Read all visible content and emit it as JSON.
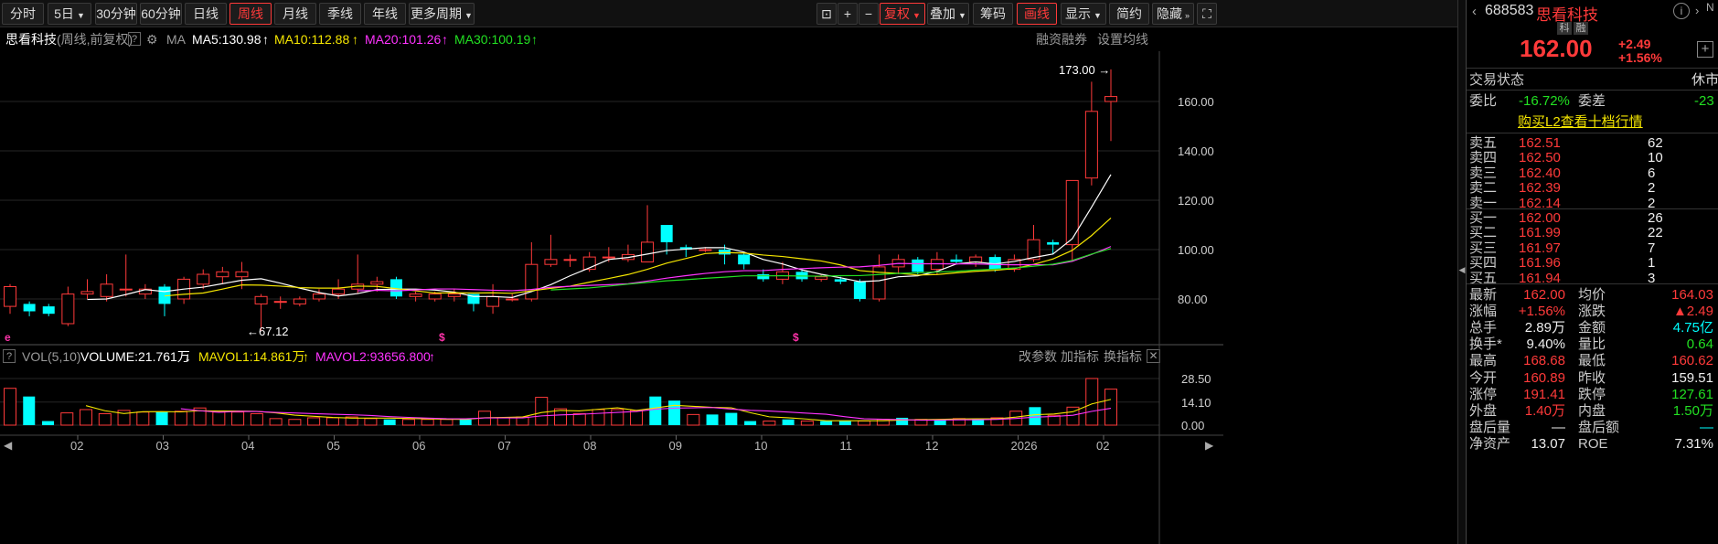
{
  "toolbar": {
    "periods": [
      "分时",
      "5日",
      "30分钟",
      "60分钟",
      "日线",
      "周线",
      "月线",
      "季线",
      "年线",
      "更多周期"
    ],
    "active_period": "周线",
    "tools": [
      "复权",
      "叠加",
      "筹码",
      "画线",
      "显示",
      "简约",
      "隐藏"
    ],
    "active_tools": [
      "复权",
      "画线"
    ]
  },
  "header": {
    "stock_name": "思看科技",
    "mode": "(周线,前复权)",
    "help": "?",
    "ma_label": "MA",
    "ma5": "MA5:130.98",
    "ma10": "MA10:112.88",
    "ma20": "MA20:101.26",
    "ma30": "MA30:100.19",
    "margin_trading": "融资融券",
    "ma_settings": "设置均线"
  },
  "volume_header": {
    "label": "VOL(5,10)",
    "volume": "VOLUME:21.761万",
    "mavol1": "MAVOL1:14.861万",
    "mavol2": "MAVOL2:93656.800",
    "edit_params": "改参数",
    "add_indicator": "加指标",
    "switch_indicator": "换指标"
  },
  "chart_data": {
    "type": "candlestick",
    "price_axis": [
      160,
      140,
      120,
      100,
      80
    ],
    "price_axis_labels": [
      "160.00",
      "140.00",
      "120.00",
      "100.00",
      "80.00"
    ],
    "vol_axis_labels": [
      "28.50",
      "14.10",
      "0.00"
    ],
    "x_tick_labels": [
      "02",
      "03",
      "04",
      "05",
      "06",
      "07",
      "08",
      "09",
      "10",
      "11",
      "12",
      "2026",
      "02"
    ],
    "max_marker": "173.00",
    "min_marker": "67.12",
    "candles": [
      [
        77,
        85,
        74,
        86
      ],
      [
        78,
        75,
        73,
        79
      ],
      [
        77,
        74,
        73,
        78
      ],
      [
        70,
        82,
        69,
        85
      ],
      [
        82,
        83,
        80,
        88
      ],
      [
        81,
        86,
        79,
        90
      ],
      [
        84,
        84,
        81,
        98
      ],
      [
        82,
        84,
        80,
        86
      ],
      [
        85,
        78,
        73,
        86
      ],
      [
        80,
        88,
        78,
        89
      ],
      [
        86,
        90,
        84,
        92
      ],
      [
        89,
        91,
        86,
        93
      ],
      [
        89,
        91,
        84,
        95
      ],
      [
        78,
        81,
        67.12,
        82
      ],
      [
        79,
        79,
        76,
        81
      ],
      [
        78,
        80,
        77,
        81
      ],
      [
        80,
        82,
        79,
        84
      ],
      [
        82,
        84,
        80,
        88
      ],
      [
        84,
        86,
        82,
        98
      ],
      [
        86,
        87,
        83,
        89
      ],
      [
        88,
        81,
        80,
        89
      ],
      [
        81,
        82,
        79,
        83
      ],
      [
        80,
        82,
        79,
        83
      ],
      [
        81,
        82,
        79,
        84
      ],
      [
        82,
        78,
        75,
        82
      ],
      [
        77,
        81,
        74,
        86
      ],
      [
        80,
        80,
        79,
        82
      ],
      [
        80,
        94,
        79,
        103
      ],
      [
        94,
        96,
        93,
        106
      ],
      [
        96,
        96,
        93,
        98
      ],
      [
        92,
        97,
        91,
        99
      ],
      [
        97,
        97,
        95,
        101
      ],
      [
        96,
        98,
        95,
        102
      ],
      [
        95,
        103,
        95,
        118
      ],
      [
        110,
        103,
        98,
        110
      ],
      [
        101,
        100,
        97,
        102
      ],
      [
        100,
        100,
        99,
        101
      ],
      [
        100,
        98,
        94,
        102
      ],
      [
        98,
        94,
        92,
        99
      ],
      [
        90,
        88,
        87,
        92
      ],
      [
        88,
        91,
        86,
        95
      ],
      [
        91,
        88,
        87,
        92
      ],
      [
        88,
        89,
        87,
        90
      ],
      [
        88,
        87,
        86,
        89
      ],
      [
        87,
        80,
        79,
        88
      ],
      [
        80,
        93,
        79,
        98
      ],
      [
        93,
        96,
        90,
        98
      ],
      [
        96,
        91,
        90,
        97
      ],
      [
        92,
        96,
        90,
        99
      ],
      [
        96,
        95,
        94,
        98
      ],
      [
        95,
        97,
        93,
        98
      ],
      [
        97,
        92,
        91,
        98
      ],
      [
        92,
        96,
        91,
        98
      ],
      [
        96,
        104,
        95,
        110
      ],
      [
        103,
        102,
        98,
        104
      ],
      [
        102,
        128,
        95,
        128
      ],
      [
        129,
        156,
        126,
        168
      ],
      [
        160,
        162,
        144,
        173
      ]
    ],
    "volumes": [
      22.5,
      17.5,
      2.5,
      7.5,
      9.5,
      7,
      9,
      8,
      8,
      8.5,
      10.5,
      8,
      8,
      7,
      4,
      3.5,
      4.5,
      4.5,
      5,
      4,
      3.5,
      3.5,
      3.5,
      3.5,
      3.5,
      8.5,
      4.5,
      5,
      17,
      10,
      7,
      9.5,
      9.5,
      9,
      17.5,
      15,
      6.5,
      6.5,
      7.5,
      2.5,
      2.5,
      3.5,
      2.5,
      2.5,
      2.5,
      2.5,
      3.5,
      4.5,
      3.5,
      3.5,
      4,
      4,
      4.5,
      8.5,
      11,
      6,
      11,
      28.5,
      22
    ],
    "series": [
      {
        "name": "MA5",
        "color": "#ffffff"
      },
      {
        "name": "MA10",
        "color": "#f5e600"
      },
      {
        "name": "MA20",
        "color": "#ff33ff"
      },
      {
        "name": "MA30",
        "color": "#22e022"
      }
    ],
    "colors": {
      "up": "#ff3a3a",
      "down": "#00ffff"
    }
  },
  "panel": {
    "code": "688583",
    "name": "思看科技",
    "tags": [
      "科",
      "融"
    ],
    "price": "162.00",
    "change": "+2.49",
    "change_pct": "+1.56%",
    "trade_status_label": "交易状态",
    "trade_status": "休市",
    "bid_ratio_label": "委比",
    "bid_ratio": "-16.72%",
    "bid_diff_label": "委差",
    "bid_diff": "-23",
    "level2_link": "购买L2查看十档行情",
    "asks": [
      {
        "label": "卖五",
        "price": "162.51",
        "vol": "62"
      },
      {
        "label": "卖四",
        "price": "162.50",
        "vol": "10"
      },
      {
        "label": "卖三",
        "price": "162.40",
        "vol": "6"
      },
      {
        "label": "卖二",
        "price": "162.39",
        "vol": "2"
      },
      {
        "label": "卖一",
        "price": "162.14",
        "vol": "2"
      }
    ],
    "bids": [
      {
        "label": "买一",
        "price": "162.00",
        "vol": "26"
      },
      {
        "label": "买二",
        "price": "161.99",
        "vol": "22"
      },
      {
        "label": "买三",
        "price": "161.97",
        "vol": "7"
      },
      {
        "label": "买四",
        "price": "161.96",
        "vol": "1"
      },
      {
        "label": "买五",
        "price": "161.94",
        "vol": "3"
      }
    ],
    "stats": [
      {
        "l1": "最新",
        "v1": "162.00",
        "c1": "red",
        "l2": "均价",
        "v2": "164.03",
        "c2": "red"
      },
      {
        "l1": "涨幅",
        "v1": "+1.56%",
        "c1": "red",
        "l2": "涨跌",
        "v2": "▲2.49",
        "c2": "red"
      },
      {
        "l1": "总手",
        "v1": "2.89万",
        "c1": "white",
        "l2": "金额",
        "v2": "4.75亿",
        "c2": "cyan"
      },
      {
        "l1": "换手*",
        "v1": "9.40%",
        "c1": "white",
        "l2": "量比",
        "v2": "0.64",
        "c2": "green"
      },
      {
        "l1": "最高",
        "v1": "168.68",
        "c1": "red",
        "l2": "最低",
        "v2": "160.62",
        "c2": "red"
      },
      {
        "l1": "今开",
        "v1": "160.89",
        "c1": "red",
        "l2": "昨收",
        "v2": "159.51",
        "c2": "white"
      },
      {
        "l1": "涨停",
        "v1": "191.41",
        "c1": "red",
        "l2": "跌停",
        "v2": "127.61",
        "c2": "green"
      },
      {
        "l1": "外盘",
        "v1": "1.40万",
        "c1": "red",
        "l2": "内盘",
        "v2": "1.50万",
        "c2": "green"
      },
      {
        "l1": "盘后量",
        "v1": "—",
        "c1": "white",
        "l2": "盘后额",
        "v2": "—",
        "c2": "cyan"
      },
      {
        "l1": "净资产",
        "v1": "13.07",
        "c1": "white",
        "l2": "ROE",
        "v2": "7.31%",
        "c2": "white"
      }
    ]
  }
}
